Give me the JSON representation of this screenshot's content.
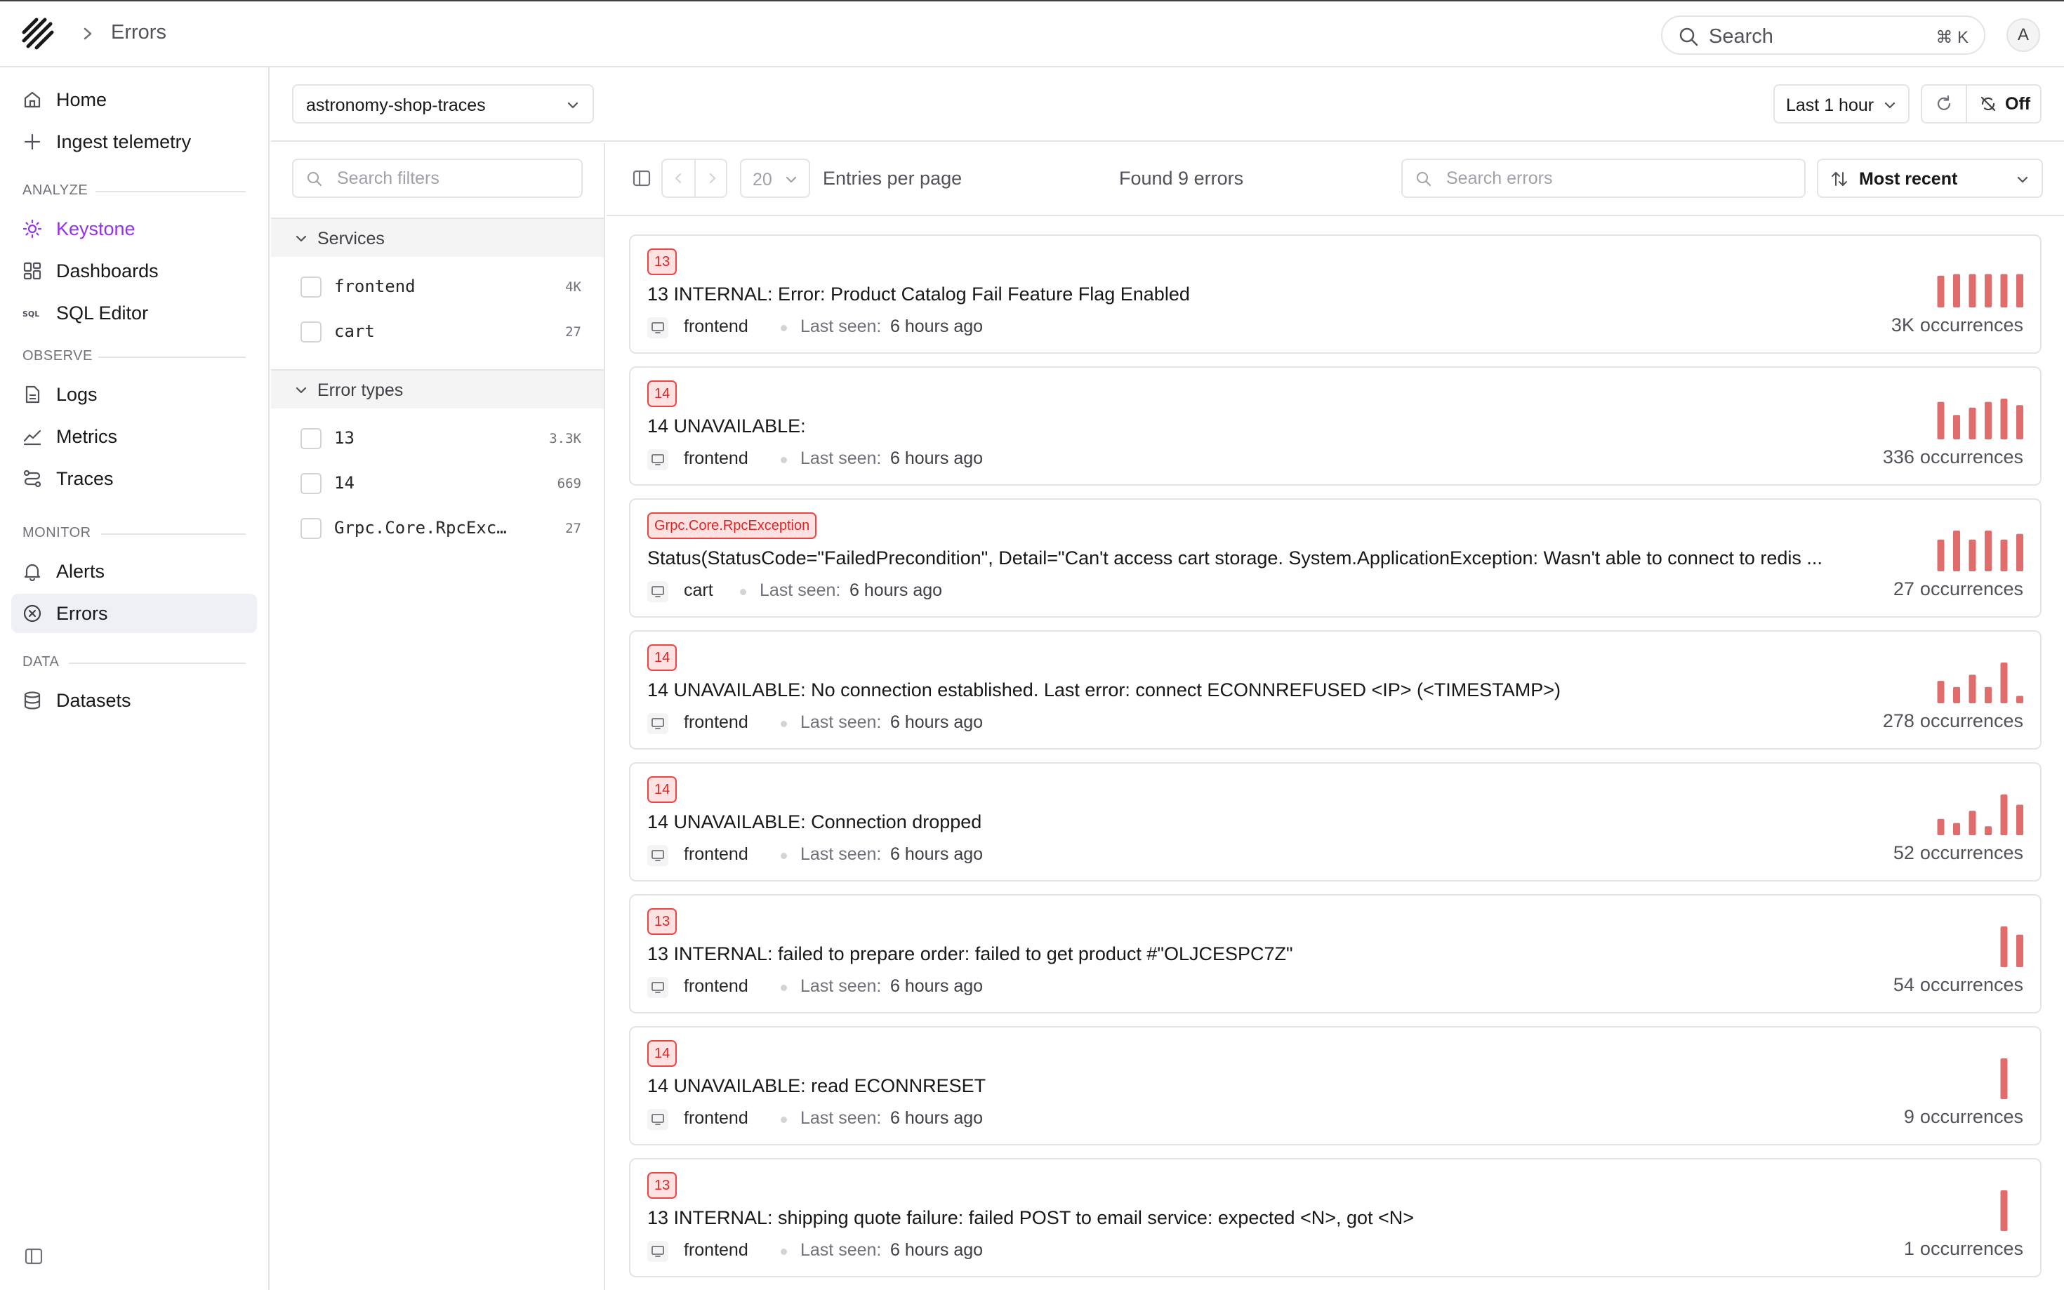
{
  "header": {
    "breadcrumb_title": "Errors",
    "search_label": "Search",
    "search_shortcut": "⌘ K",
    "avatar_initial": "A"
  },
  "sidebar": {
    "top_items": [
      {
        "label": "Home",
        "icon": "home-icon"
      },
      {
        "label": "Ingest telemetry",
        "icon": "plus-icon"
      }
    ],
    "sections": [
      {
        "title": "ANALYZE",
        "items": [
          {
            "label": "Keystone",
            "icon": "lightbulb-icon"
          },
          {
            "label": "Dashboards",
            "icon": "dashboard-icon"
          },
          {
            "label": "SQL Editor",
            "icon": "sql-icon"
          }
        ]
      },
      {
        "title": "OBSERVE",
        "items": [
          {
            "label": "Logs",
            "icon": "file-icon"
          },
          {
            "label": "Metrics",
            "icon": "chart-line-icon"
          },
          {
            "label": "Traces",
            "icon": "traces-icon"
          }
        ]
      },
      {
        "title": "MONITOR",
        "items": [
          {
            "label": "Alerts",
            "icon": "bell-icon"
          },
          {
            "label": "Errors",
            "icon": "x-circle-icon"
          }
        ]
      },
      {
        "title": "DATA",
        "items": [
          {
            "label": "Datasets",
            "icon": "database-icon"
          }
        ]
      }
    ],
    "active_item": "Errors",
    "highlight_item": "Keystone",
    "highlight_color": "#9333ea"
  },
  "toolbar": {
    "dataset": "astronomy-shop-traces",
    "time_range": "Last 1 hour",
    "auto_refresh": "Off"
  },
  "filters": {
    "search_placeholder": "Search filters",
    "groups": [
      {
        "title": "Services",
        "facets": [
          {
            "name": "frontend",
            "count": "4K"
          },
          {
            "name": "cart",
            "count": "27"
          }
        ]
      },
      {
        "title": "Error types",
        "facets": [
          {
            "name": "13",
            "count": "3.3K"
          },
          {
            "name": "14",
            "count": "669"
          },
          {
            "name": "Grpc.Core.RpcExc…",
            "count": "27"
          }
        ]
      }
    ]
  },
  "errors_toolbar": {
    "per_page": "20",
    "per_page_label": "Entries per page",
    "found_text": "Found 9 errors",
    "search_placeholder": "Search errors",
    "sort": "Most recent"
  },
  "error_colors": {
    "badge_border": "#ef4444",
    "badge_bg": "#fee2e2",
    "badge_text": "#dc2626",
    "bar": "#e06c6c"
  },
  "errors": [
    {
      "badge": "13",
      "message": "13 INTERNAL: Error: Product Catalog Fail Feature Flag Enabled",
      "service": "frontend",
      "last_seen_label": "Last seen:",
      "last_seen": "6 hours ago",
      "occurrences": "3K",
      "occurrences_label": "occurrences",
      "bars": [
        0.78,
        0.82,
        0.82,
        0.82,
        0.82,
        0.82
      ]
    },
    {
      "badge": "14",
      "message": "14 UNAVAILABLE:",
      "service": "frontend",
      "last_seen_label": "Last seen:",
      "last_seen": "6 hours ago",
      "occurrences": "336",
      "occurrences_label": "occurrences",
      "bars": [
        0.92,
        0.6,
        0.78,
        0.92,
        1.0,
        0.84
      ]
    },
    {
      "badge": "Grpc.Core.RpcException",
      "message": "Status(StatusCode=\"FailedPrecondition\", Detail=\"Can't access cart storage. System.ApplicationException: Wasn't able to connect to redis ...",
      "service": "cart",
      "last_seen_label": "Last seen:",
      "last_seen": "6 hours ago",
      "occurrences": "27",
      "occurrences_label": "occurrences",
      "bars": [
        0.78,
        1.0,
        0.78,
        1.0,
        0.78,
        0.92
      ]
    },
    {
      "badge": "14",
      "message": "14 UNAVAILABLE: No connection established. Last error: connect ECONNREFUSED <IP> (<TIMESTAMP>)",
      "service": "frontend",
      "last_seen_label": "Last seen:",
      "last_seen": "6 hours ago",
      "occurrences": "278",
      "occurrences_label": "occurrences",
      "bars": [
        0.55,
        0.4,
        0.7,
        0.4,
        1.0,
        0.18
      ]
    },
    {
      "badge": "14",
      "message": "14 UNAVAILABLE: Connection dropped",
      "service": "frontend",
      "last_seen_label": "Last seen:",
      "last_seen": "6 hours ago",
      "occurrences": "52",
      "occurrences_label": "occurrences",
      "bars": [
        0.4,
        0.3,
        0.6,
        0.22,
        1.0,
        0.75
      ]
    },
    {
      "badge": "13",
      "message": "13 INTERNAL: failed to prepare order: failed to get product #\"OLJCESPC7Z\"",
      "service": "frontend",
      "last_seen_label": "Last seen:",
      "last_seen": "6 hours ago",
      "occurrences": "54",
      "occurrences_label": "occurrences",
      "bars": [
        0,
        0,
        0,
        0,
        1.0,
        0.8
      ]
    },
    {
      "badge": "14",
      "message": "14 UNAVAILABLE: read ECONNRESET",
      "service": "frontend",
      "last_seen_label": "Last seen:",
      "last_seen": "6 hours ago",
      "occurrences": "9",
      "occurrences_label": "occurrences",
      "bars": [
        0,
        0,
        0,
        0,
        1.0,
        0
      ]
    },
    {
      "badge": "13",
      "message": "13 INTERNAL: shipping quote failure: failed POST to email service: expected <N>, got <N>",
      "service": "frontend",
      "last_seen_label": "Last seen:",
      "last_seen": "6 hours ago",
      "occurrences": "1",
      "occurrences_label": "occurrences",
      "bars": [
        0,
        0,
        0,
        0,
        1.0,
        0
      ]
    }
  ]
}
